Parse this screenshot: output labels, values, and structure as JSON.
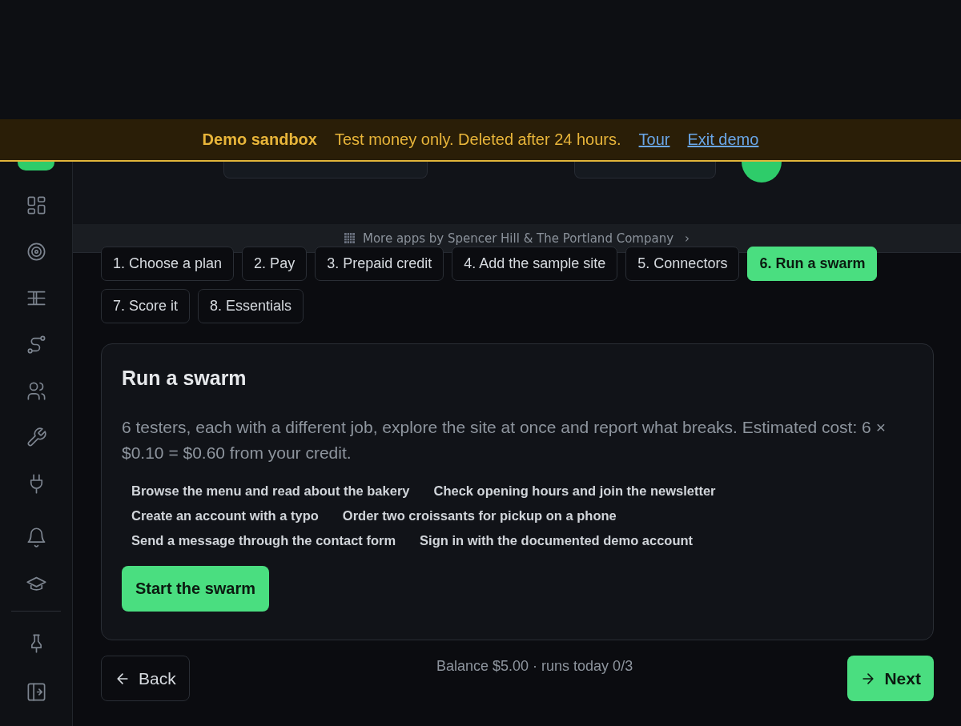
{
  "banner": {
    "title": "Demo sandbox",
    "message": "Test money only. Deleted after 24 hours.",
    "links": [
      "Tour",
      "Exit demo"
    ]
  },
  "more_apps": {
    "label": "More apps by Spencer Hill & The Portland Company",
    "chevron": "›"
  },
  "steps": [
    {
      "label": "1. Choose a plan",
      "selected": false
    },
    {
      "label": "2. Pay",
      "selected": false
    },
    {
      "label": "3. Prepaid credit",
      "selected": false
    },
    {
      "label": "4. Add the sample site",
      "selected": false
    },
    {
      "label": "5. Connectors",
      "selected": false
    },
    {
      "label": "6. Run a swarm",
      "selected": true
    },
    {
      "label": "7. Score it",
      "selected": false
    },
    {
      "label": "8. Essentials",
      "selected": false
    }
  ],
  "card": {
    "title": "Run a swarm",
    "description": "6 testers, each with a different job, explore the site at once and report what breaks. Estimated cost: 6 × $0.10 = $0.60 from your credit.",
    "testers": [
      "Browse the menu and read about the bakery",
      "Check opening hours and join the newsletter",
      "Create an account with a typo",
      "Order two croissants for pickup on a phone",
      "Send a message through the contact form",
      "Sign in with the documented demo account"
    ],
    "button": "Start the swarm"
  },
  "footer": {
    "back": "Back",
    "status": "Balance $5.00 · runs today 0/3",
    "next": "Next"
  }
}
